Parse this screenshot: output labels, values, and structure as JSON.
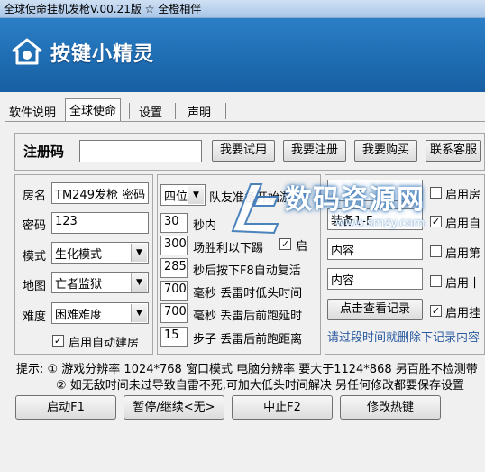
{
  "window": {
    "title": "全球使命挂机发枪V.00.21版 ☆ 全橙相伴"
  },
  "banner": {
    "logo_text": "按键小精灵"
  },
  "tabs": [
    "软件说明",
    "全球使命",
    "设置",
    "声明"
  ],
  "registration": {
    "label": "注册码",
    "value": "",
    "buttons": [
      "我要试用",
      "我要注册",
      "我要购买",
      "联系客服"
    ]
  },
  "left_group": {
    "room_label": "房名",
    "room_value": "TM249发枪 密码",
    "password_label": "密码",
    "password_value": "123",
    "mode_label": "模式",
    "mode_value": "生化模式",
    "map_label": "地图",
    "map_value": "亡者监狱",
    "difficulty_label": "难度",
    "difficulty_value": "困难难度",
    "auto_room_label": "启用自动建房",
    "auto_room_checked": true
  },
  "middle_group": {
    "position_value": "四位",
    "position_text": "队友准备开始游",
    "rows": [
      {
        "value": "30",
        "text": "秒内"
      },
      {
        "value": "300",
        "text": "场胜利以下踢"
      },
      {
        "value": "285",
        "text": "秒后按下F8自动复活"
      },
      {
        "value": "700",
        "text": "毫秒 丢雷时低头时间"
      },
      {
        "value": "700",
        "text": "毫秒 丢雷后前跑延时"
      },
      {
        "value": "15",
        "text": "步子 丢雷后前跑距离"
      }
    ],
    "kick_checkbox_label": "启",
    "kick_checked": true
  },
  "right_group": {
    "inputs": [
      "",
      "装备1-F",
      "内容",
      "内容"
    ],
    "view_log_button": "点击查看记录",
    "note": "请过段时间就删除下记录内容",
    "checks": [
      {
        "label": "启用房",
        "checked": false
      },
      {
        "label": "启用自",
        "checked": true
      },
      {
        "label": "启用第",
        "checked": false
      },
      {
        "label": "启用十",
        "checked": false
      },
      {
        "label": "启用挂",
        "checked": true
      }
    ]
  },
  "hints": {
    "line1": "提示: ① 游戏分辨率 1024*768 窗口模式 电脑分辨率 要大于1124*868 另百胜不检测带",
    "line2": "② 如无敌时间未过导致自雷不死,可加大低头时间解决 另任何修改都要保存设置"
  },
  "bottom_buttons": [
    "启动F1",
    "暂停/继续<无>",
    "中止F2",
    "修改热键"
  ],
  "watermark": {
    "text": "数码资源网",
    "url": "www.smzy.com"
  }
}
